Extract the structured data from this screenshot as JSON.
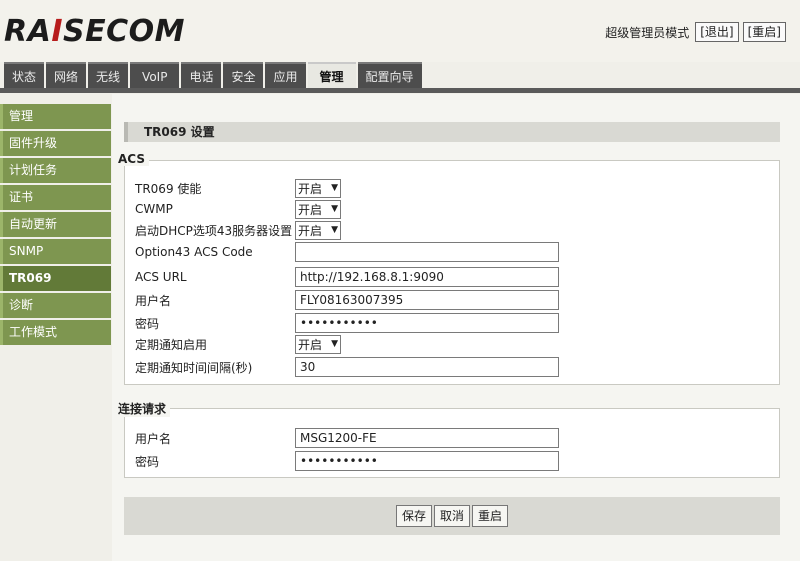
{
  "header": {
    "logo_main": "RA",
    "logo_accent": "I",
    "logo_rest": "SECOM",
    "mode_label": "超级管理员模式",
    "logout_label": "[退出]",
    "restart_label": "[重启]"
  },
  "tabs": [
    {
      "label": "状态"
    },
    {
      "label": "网络"
    },
    {
      "label": "无线"
    },
    {
      "label": "VoIP"
    },
    {
      "label": "电话"
    },
    {
      "label": "安全"
    },
    {
      "label": "应用"
    },
    {
      "label": "管理"
    },
    {
      "label": "配置向导"
    }
  ],
  "sidebar": {
    "items": [
      {
        "label": "管理"
      },
      {
        "label": "固件升级"
      },
      {
        "label": "计划任务"
      },
      {
        "label": "证书"
      },
      {
        "label": "自动更新"
      },
      {
        "label": "SNMP"
      },
      {
        "label": "TR069"
      },
      {
        "label": "诊断"
      },
      {
        "label": "工作模式"
      }
    ]
  },
  "page": {
    "title": "TR069 设置",
    "acs": {
      "legend": "ACS",
      "tr069_enable": {
        "label": "TR069 使能",
        "value": "开启"
      },
      "cwmp": {
        "label": "CWMP",
        "value": "开启"
      },
      "dhcp43": {
        "label": "启动DHCP选项43服务器设置",
        "value": "开启"
      },
      "option43": {
        "label": "Option43 ACS Code",
        "value": ""
      },
      "acs_url": {
        "label": "ACS URL",
        "value": "http://192.168.8.1:9090"
      },
      "username": {
        "label": "用户名",
        "value": "FLY08163007395"
      },
      "password": {
        "label": "密码",
        "value": "•••••••••••"
      },
      "periodic_enable": {
        "label": "定期通知启用",
        "value": "开启"
      },
      "periodic_interval": {
        "label": "定期通知时间间隔(秒)",
        "value": "30"
      }
    },
    "conn": {
      "legend": "连接请求",
      "username": {
        "label": "用户名",
        "value": "MSG1200-FE"
      },
      "password": {
        "label": "密码",
        "value": "•••••••••••"
      }
    },
    "buttons": {
      "save": "保存",
      "cancel": "取消",
      "reboot": "重启"
    }
  }
}
